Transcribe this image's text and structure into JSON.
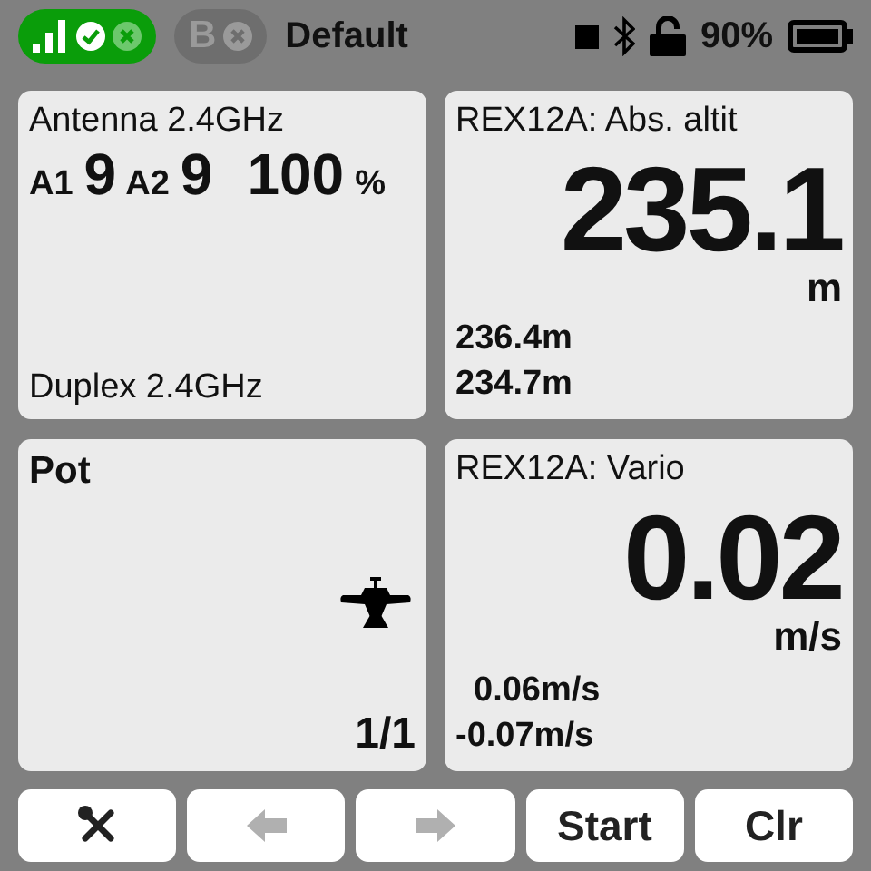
{
  "status_bar": {
    "pills": [
      {
        "kind": "signal",
        "connected": true
      },
      {
        "kind": "letter",
        "label": "B",
        "connected": false
      }
    ],
    "model_name": "Default",
    "battery": "90%"
  },
  "widgets": [
    {
      "kind": "rssi",
      "title": "Antenna 2.4GHz",
      "a1_label": "A1",
      "a1_value": "9",
      "a2_label": "A2",
      "a2_value": "9",
      "percent": "100",
      "percent_unit": "%",
      "footer": "Duplex 2.4GHz"
    },
    {
      "kind": "sensor",
      "title": "REX12A: Abs. altit",
      "value": "235.1",
      "unit": "m",
      "max": "236.4m",
      "min": "234.7m"
    },
    {
      "kind": "model",
      "title": "Pot",
      "page": "1/1"
    },
    {
      "kind": "sensor",
      "title": "REX12A: Vario",
      "value": "0.02",
      "unit": "m/s",
      "max": "0.06m/s",
      "min": "-0.07m/s"
    }
  ],
  "buttons": [
    {
      "kind": "tools",
      "disabled": false
    },
    {
      "kind": "prev",
      "disabled": true
    },
    {
      "kind": "next",
      "disabled": true
    },
    {
      "kind": "text",
      "label": "Start",
      "disabled": false
    },
    {
      "kind": "text",
      "label": "Clr",
      "disabled": false
    }
  ]
}
